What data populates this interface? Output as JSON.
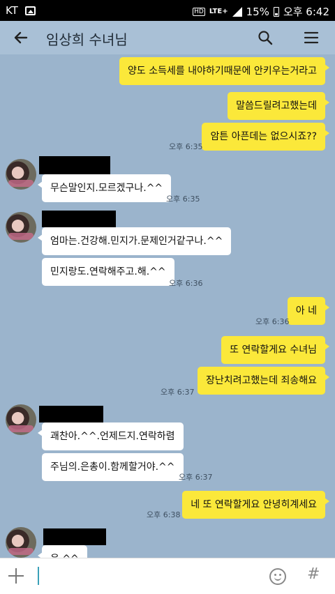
{
  "status_bar": {
    "carrier": "KT",
    "battery": "15%",
    "time": "오후 6:42",
    "network": "LTE+",
    "hd": "HD"
  },
  "header": {
    "title": "임상희 수녀님",
    "icons": {
      "back": "arrow-left-icon",
      "search": "search-icon",
      "menu": "hamburger-menu-icon"
    }
  },
  "messages": [
    {
      "from": "me",
      "text": "양도 소득세를 내야하기때문에 안키우는거라고"
    },
    {
      "from": "me",
      "text": "말씀드릴려고했는데"
    },
    {
      "from": "me",
      "text": "암튼 아픈데는 없으시죠??",
      "time": "오후 6:35"
    },
    {
      "from": "other",
      "text": "무슨말인지.모르겠구나.^^",
      "time": "오후 6:35"
    },
    {
      "from": "other",
      "text": "엄마는.건강해.민지가.문제인거같구나.^^"
    },
    {
      "from": "other",
      "text": "민지랑도.연락해주고.해.^^",
      "time": "오후 6:36"
    },
    {
      "from": "me",
      "text": "아 네",
      "time": "오후 6:36"
    },
    {
      "from": "me",
      "text": "또 연락할게요 수녀님"
    },
    {
      "from": "me",
      "text": "장난치려고했는데 죄송해요",
      "time": "오후 6:37"
    },
    {
      "from": "other",
      "text": "괘찬아.^^.언제드지.연락하렴"
    },
    {
      "from": "other",
      "text": "주님의.은총이.함께할거야.^^",
      "time": "오후 6:37"
    },
    {
      "from": "me",
      "text": "네 또 연락할게요 안녕히계세요",
      "time": "오후 6:38"
    },
    {
      "from": "other",
      "text": "응.^^"
    }
  ],
  "input": {
    "placeholder": ""
  },
  "colors": {
    "chat_bg": "#9bb4cc",
    "my_bubble": "#fbe83a",
    "other_bubble": "#ffffff"
  }
}
